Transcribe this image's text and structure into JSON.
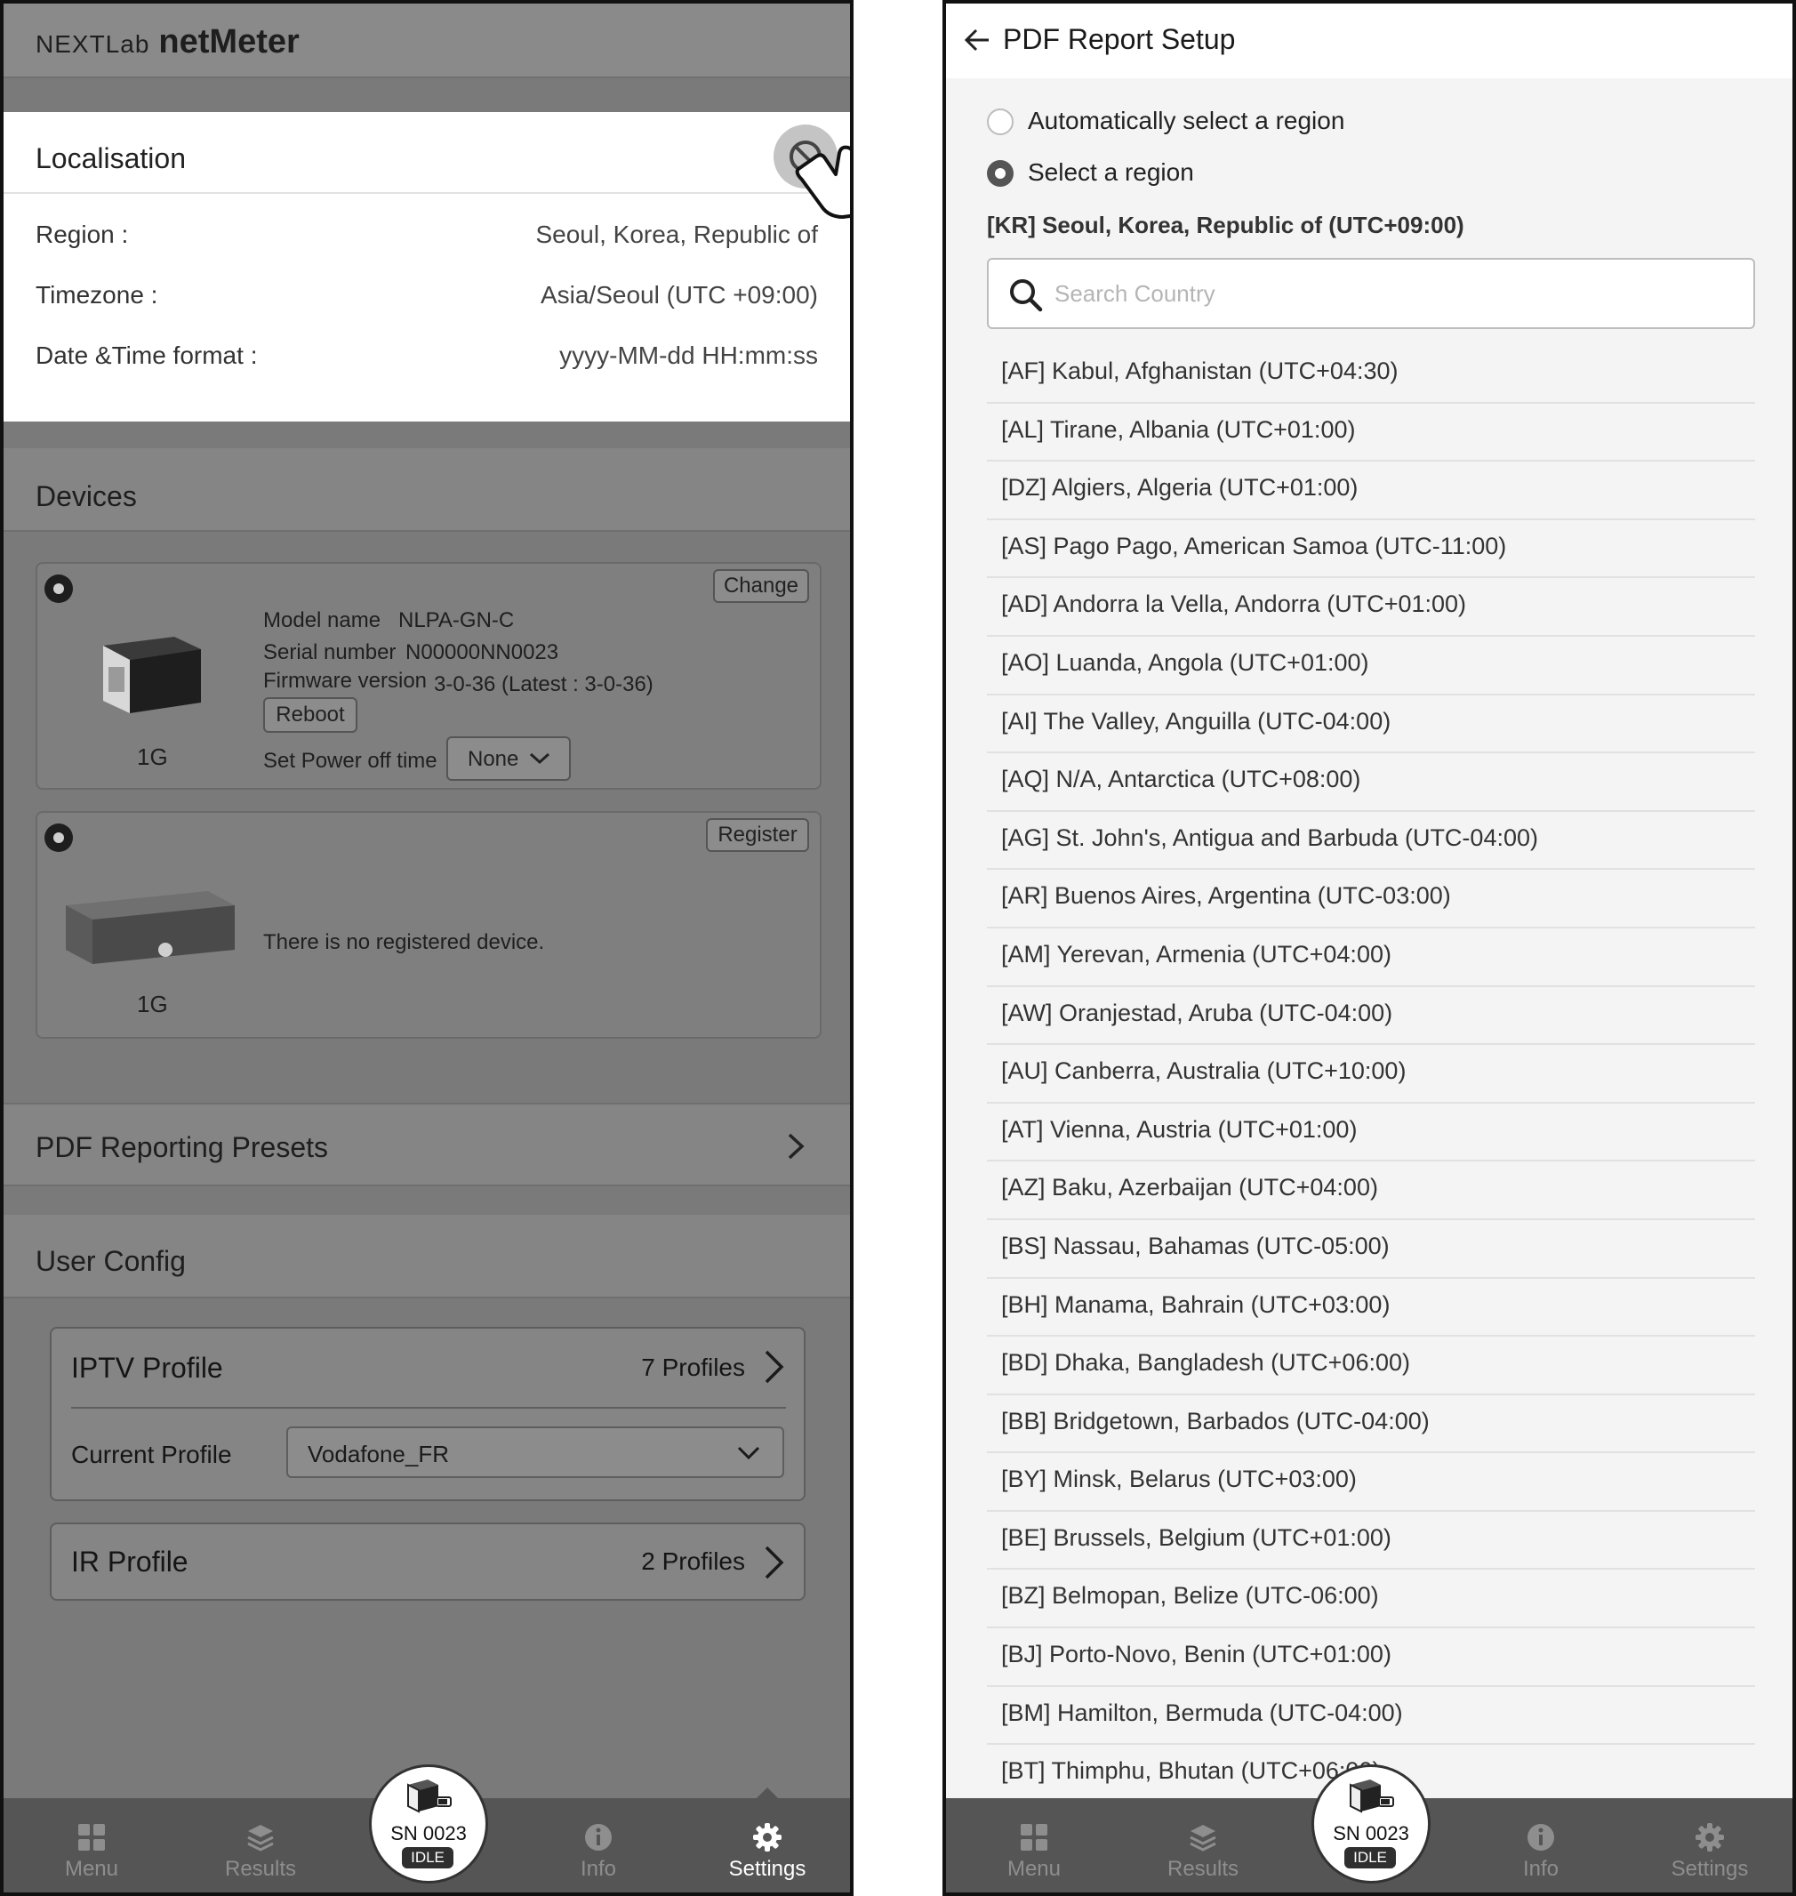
{
  "left": {
    "app_header": {
      "brand_prefix": "NEXTLab",
      "brand_name": "netMeter"
    },
    "localisation": {
      "title": "Localisation",
      "rows": [
        {
          "label": "Region :",
          "value": "Seoul, Korea, Republic of"
        },
        {
          "label": "Timezone :",
          "value": "Asia/Seoul (UTC +09:00)"
        },
        {
          "label": "Date &Time format :",
          "value": "yyyy-MM-dd HH:mm:ss"
        }
      ]
    },
    "devices": {
      "title": "Devices",
      "device1": {
        "change_label": "Change",
        "model_label": "Model name",
        "model_value": "NLPA-GN-C",
        "serial_label": "Serial number",
        "serial_value": "N00000NN0023",
        "firmware_label": "Firmware version",
        "firmware_value": "3-0-36 (Latest : 3-0-36)",
        "reboot_label": "Reboot",
        "power_off_label": "Set Power off time",
        "power_off_value": "None",
        "speed": "1G"
      },
      "device2": {
        "register_label": "Register",
        "empty_text": "There is no registered device.",
        "speed": "1G"
      }
    },
    "pdf_presets": {
      "title": "PDF Reporting Presets"
    },
    "user_config": {
      "title": "User Config",
      "iptv": {
        "name": "IPTV Profile",
        "count": "7 Profiles",
        "current_label": "Current Profile",
        "current_value": "Vodafone_FR"
      },
      "ir": {
        "name": "IR Profile",
        "count": "2 Profiles"
      }
    }
  },
  "right": {
    "header": {
      "title": "PDF Report Setup"
    },
    "options": [
      {
        "label": "Automatically select a region",
        "selected": false
      },
      {
        "label": "Select a region",
        "selected": true
      }
    ],
    "selected_region": "[KR] Seoul, Korea, Republic of (UTC+09:00)",
    "search": {
      "placeholder": "Search Country",
      "value": ""
    },
    "countries": [
      "[AF] Kabul, Afghanistan (UTC+04:30)",
      "[AL] Tirane, Albania (UTC+01:00)",
      "[DZ] Algiers, Algeria (UTC+01:00)",
      "[AS] Pago Pago, American Samoa (UTC-11:00)",
      "[AD] Andorra la Vella, Andorra (UTC+01:00)",
      "[AO] Luanda, Angola (UTC+01:00)",
      "[AI] The Valley, Anguilla (UTC-04:00)",
      "[AQ] N/A, Antarctica (UTC+08:00)",
      "[AG] St. John's, Antigua and Barbuda (UTC-04:00)",
      "[AR] Buenos Aires, Argentina (UTC-03:00)",
      "[AM] Yerevan, Armenia (UTC+04:00)",
      "[AW] Oranjestad, Aruba (UTC-04:00)",
      "[AU] Canberra, Australia (UTC+10:00)",
      "[AT] Vienna, Austria (UTC+01:00)",
      "[AZ] Baku, Azerbaijan (UTC+04:00)",
      "[BS] Nassau, Bahamas (UTC-05:00)",
      "[BH] Manama, Bahrain (UTC+03:00)",
      "[BD] Dhaka, Bangladesh (UTC+06:00)",
      "[BB] Bridgetown, Barbados (UTC-04:00)",
      "[BY] Minsk, Belarus (UTC+03:00)",
      "[BE] Brussels, Belgium (UTC+01:00)",
      "[BZ] Belmopan, Belize (UTC-06:00)",
      "[BJ] Porto-Novo, Benin (UTC+01:00)",
      "[BM] Hamilton, Bermuda (UTC-04:00)",
      "[BT] Thimphu, Bhutan (UTC+06:00)"
    ]
  },
  "nav": {
    "items": [
      {
        "label": "Menu",
        "icon": "grid-icon"
      },
      {
        "label": "Results",
        "icon": "layers-icon"
      },
      {
        "label": "Info",
        "icon": "info-icon"
      },
      {
        "label": "Settings",
        "icon": "gear-icon"
      }
    ],
    "device": {
      "sn": "SN 0023",
      "status": "IDLE"
    },
    "left_active": "Settings"
  },
  "colors": {
    "overlay_gray": "#7a7a7a",
    "nav_bg": "#555555",
    "active_white": "#ffffff"
  }
}
